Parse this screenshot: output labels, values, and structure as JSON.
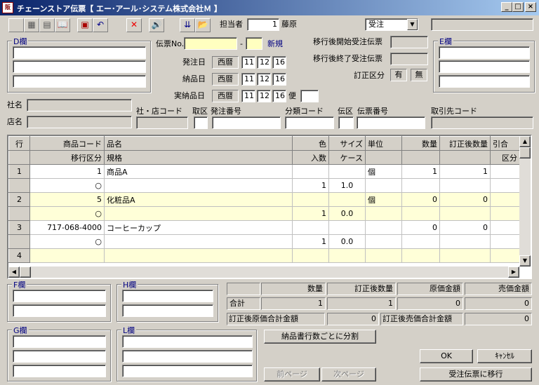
{
  "window": {
    "app_icon": "阪",
    "title": "チェーンストア伝票【 エー･アール･システム株式会社Ｍ 】",
    "buttons": [
      "_",
      "□",
      "×"
    ]
  },
  "toolbar": {
    "icons": [
      "blank-icon",
      "grid-icon",
      "list-icon",
      "book-icon",
      "save-icon",
      "undo-icon",
      "delete-icon",
      "speaker-icon",
      "export-icon",
      "folder-icon"
    ],
    "tantousha_label": "担当者",
    "tantousha_code": "1",
    "tantousha_name": "藤原",
    "mode_select": "受注"
  },
  "d_field": {
    "title": "D欄"
  },
  "e_field": {
    "title": "E欄"
  },
  "f_field": {
    "title": "F欄"
  },
  "g_field": {
    "title": "G欄"
  },
  "h_field": {
    "title": "H欄"
  },
  "l_field": {
    "title": "L欄"
  },
  "header": {
    "denpyo_no_label": "伝票No.",
    "denpyo_dash": "-",
    "new_label": "新規",
    "hacchubi_label": "発注日",
    "nouhinbi_label": "納品日",
    "jitsunouhinbi_label": "実納品日",
    "seireki": "西暦",
    "hacchubi": [
      "11",
      "12",
      "16"
    ],
    "nouhinbi": [
      "11",
      "12",
      "16"
    ],
    "jitsunouhinbi": [
      "11",
      "12",
      "16"
    ],
    "bin_label": "便",
    "ikou_start_label": "移行後開始受注伝票",
    "ikou_end_label": "移行後終了受注伝票",
    "teisei_label": "訂正区分",
    "teisei_yes": "有",
    "teisei_no": "無",
    "shamei_label": "社名",
    "tenmei_label": "店名",
    "shaten_code_label": "社・店コード",
    "torikubun_label": "取区",
    "hacchu_bangou_label": "発注番号",
    "bunrui_label": "分類コード",
    "denku_label": "伝区",
    "denpyo_bangou_label": "伝票番号",
    "torihikisaki_label": "取引先コード"
  },
  "grid": {
    "headers_row1": [
      "行",
      "商品コード",
      "品名",
      "色",
      "サイズ",
      "単位",
      "数量",
      "訂正後数量",
      "引合"
    ],
    "headers_row2": [
      "",
      "移行区分",
      "規格",
      "入数",
      "ケース",
      "",
      "",
      "",
      "区分"
    ],
    "rows": [
      {
        "no": "1",
        "code": "1",
        "name": "商品A",
        "color": "",
        "size": "",
        "unit": "個",
        "qty": "1",
        "qty2": "1",
        "sub_kubun": "○",
        "sub_irisuu": "1",
        "sub_case": "1.0"
      },
      {
        "no": "2",
        "code": "5",
        "name": "化粧品A",
        "color": "",
        "size": "",
        "unit": "個",
        "qty": "0",
        "qty2": "0",
        "sub_kubun": "○",
        "sub_irisuu": "1",
        "sub_case": "0.0"
      },
      {
        "no": "3",
        "code": "717-068-4000",
        "name": "コーヒーカップ",
        "color": "",
        "size": "",
        "unit": "",
        "qty": "0",
        "qty2": "0",
        "sub_kubun": "○",
        "sub_irisuu": "1",
        "sub_case": "0.0"
      },
      {
        "no": "4",
        "code": "",
        "name": "",
        "color": "",
        "size": "",
        "unit": "",
        "qty": "",
        "qty2": "",
        "sub_kubun": "",
        "sub_irisuu": "",
        "sub_case": ""
      }
    ]
  },
  "summary": {
    "col_suuryou": "数量",
    "col_teisei_suuryou": "訂正後数量",
    "col_genka": "原価金額",
    "col_baika": "売価金額",
    "goukei_label": "合計",
    "suuryou": "1",
    "teisei_suuryou": "1",
    "genka": "0",
    "baika": "0",
    "teisei_genka_label": "訂正後原価合計金額",
    "teisei_genka": "0",
    "teisei_baika_label": "訂正後売価合計金額",
    "teisei_baika": "0"
  },
  "buttons": {
    "split": "納品書行数ごとに分割",
    "prev": "前ページ",
    "next": "次ページ",
    "ok": "OK",
    "cancel": "ｷｬﾝｾﾙ",
    "transfer": "受注伝票に移行"
  }
}
